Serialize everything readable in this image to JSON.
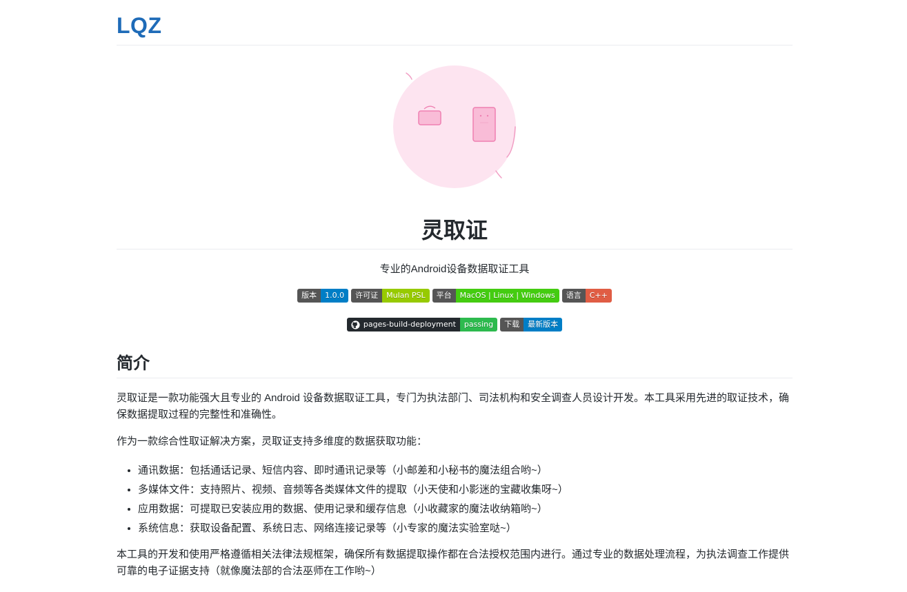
{
  "site": {
    "title": "LQZ"
  },
  "project": {
    "name": "灵取证",
    "tagline": "专业的Android设备数据取证工具"
  },
  "badges_row1": [
    {
      "label": "版本",
      "value": "1.0.0",
      "color": "#007ec6"
    },
    {
      "label": "许可证",
      "value": "Mulan PSL",
      "color": "#97ca00"
    },
    {
      "label": "平台",
      "value": "MacOS | Linux | Windows",
      "color": "#4c1"
    },
    {
      "label": "语言",
      "value": "C++",
      "color": "#e05d44"
    }
  ],
  "badges_row2": [
    {
      "label": "pages-build-deployment",
      "value": "passing",
      "color": "#2dba4e",
      "icon": "github-icon"
    },
    {
      "label": "下载",
      "value": "最新版本",
      "color": "#007ec6"
    }
  ],
  "intro": {
    "heading": "简介",
    "paragraph1": "灵取证是一款功能强大且专业的 Android 设备数据取证工具，专门为执法部门、司法机构和安全调查人员设计开发。本工具采用先进的取证技术，确保数据提取过程的完整性和准确性。",
    "paragraph2": "作为一款综合性取证解决方案，灵取证支持多维度的数据获取功能：",
    "features": [
      "通讯数据：包括通话记录、短信内容、即时通讯记录等（小邮差和小秘书的魔法组合哟~）",
      "多媒体文件：支持照片、视频、音频等各类媒体文件的提取（小天使和小影迷的宝藏收集呀~）",
      "应用数据：可提取已安装应用的数据、使用记录和缓存信息（小收藏家的魔法收纳箱哟~）",
      "系统信息：获取设备配置、系统日志、网络连接记录等（小专家的魔法实验室哒~）"
    ],
    "paragraph3": "本工具的开发和使用严格遵循相关法律法规框架，确保所有数据提取操作都在合法授权范围内进行。通过专业的数据处理流程，为执法调查工作提供可靠的电子证据支持（就像魔法部的合法巫师在工作哟~）"
  },
  "colors": {
    "link": "#1e6bb8",
    "logo_bg": "#fde4f0",
    "logo_stroke": "#ef7fb1"
  }
}
